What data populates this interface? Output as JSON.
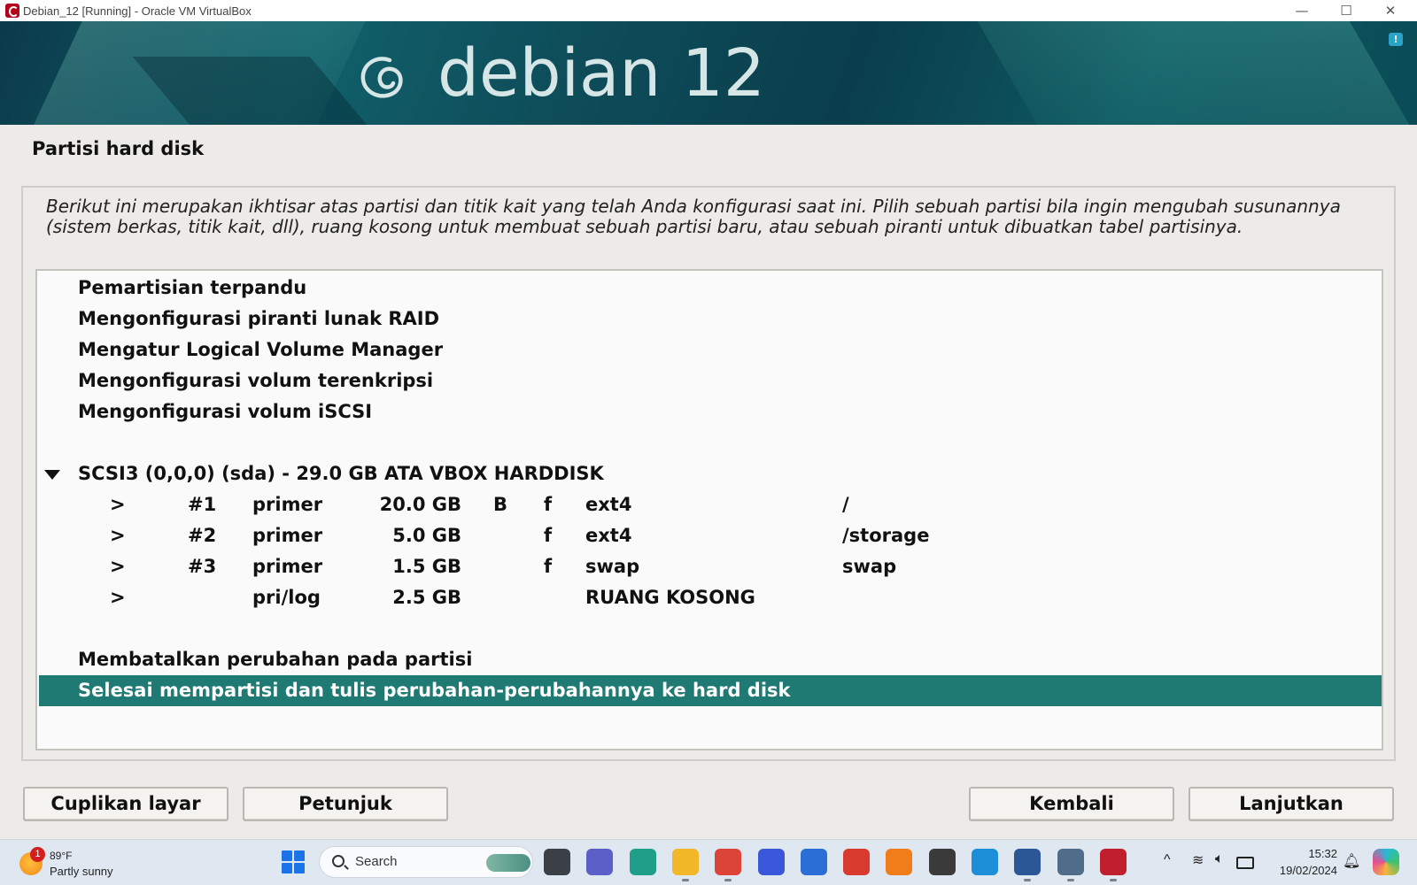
{
  "window": {
    "title": "Debian_12 [Running] - Oracle VM VirtualBox",
    "minimize_glyph": "—",
    "maximize_glyph": "☐",
    "close_glyph": "✕"
  },
  "banner": {
    "brand": "debian 12",
    "notice_glyph": "!"
  },
  "installer": {
    "title": "Partisi hard disk",
    "description": "Berikut ini merupakan ikhtisar atas partisi dan titik kait yang telah Anda konfigurasi saat ini. Pilih sebuah partisi bila ingin mengubah susunannya (sistem berkas, titik kait, dll), ruang kosong untuk membuat sebuah partisi baru, atau sebuah piranti untuk dibuatkan tabel partisinya.",
    "menu": [
      {
        "label": "Pemartisian terpandu"
      },
      {
        "label": "Mengonfigurasi piranti lunak RAID"
      },
      {
        "label": "Mengatur Logical Volume Manager"
      },
      {
        "label": "Mengonfigurasi volum terenkripsi"
      },
      {
        "label": "Mengonfigurasi volum iSCSI"
      }
    ],
    "disk": {
      "label": "SCSI3 (0,0,0) (sda) - 29.0 GB ATA VBOX HARDDISK",
      "partitions": [
        {
          "arrow": ">",
          "num": "#1",
          "type": "primer",
          "size": "20.0 GB",
          "boot": "B",
          "format": "f",
          "fs": "ext4",
          "mount": "/"
        },
        {
          "arrow": ">",
          "num": "#2",
          "type": "primer",
          "size": "5.0 GB",
          "boot": "",
          "format": "f",
          "fs": "ext4",
          "mount": "/storage"
        },
        {
          "arrow": ">",
          "num": "#3",
          "type": "primer",
          "size": "1.5 GB",
          "boot": "",
          "format": "f",
          "fs": "swap",
          "mount": "swap"
        },
        {
          "arrow": ">",
          "num": "",
          "type": "pri/log",
          "size": "2.5 GB",
          "boot": "",
          "format": "",
          "fs": "RUANG KOSONG",
          "mount": ""
        }
      ]
    },
    "undo_label": "Membatalkan perubahan pada partisi",
    "finish_label": "Selesai mempartisi dan tulis perubahan-perubahannya ke hard disk",
    "buttons": {
      "screenshot": "Cuplikan layar",
      "help": "Petunjuk",
      "back": "Kembali",
      "continue": "Lanjutkan"
    }
  },
  "taskbar": {
    "weather": {
      "badge": "1",
      "temp": "89°F",
      "condition": "Partly sunny"
    },
    "search_text": "Search",
    "tray": {
      "up_glyph": "^",
      "wifi_glyph": "≋",
      "volume_glyph": "🔈︎",
      "bell_glyph": "🔔︎"
    },
    "time": "15:32",
    "date": "19/02/2024",
    "icons": [
      {
        "name": "task-view-icon",
        "color": "#3b3f46"
      },
      {
        "name": "chat-icon",
        "color": "#5b5fc7"
      },
      {
        "name": "app-green-icon",
        "color": "#1f9e89"
      },
      {
        "name": "file-explorer-icon",
        "color": "#f2b829"
      },
      {
        "name": "chrome-icon",
        "color": "#db4437"
      },
      {
        "name": "app-m-icon",
        "color": "#3b57d9"
      },
      {
        "name": "store-icon",
        "color": "#2b6fd6"
      },
      {
        "name": "app-red-icon",
        "color": "#d83b2e"
      },
      {
        "name": "app-orange-icon",
        "color": "#f07c1a"
      },
      {
        "name": "app-g-icon",
        "color": "#3a3a3a"
      },
      {
        "name": "edge-icon",
        "color": "#1d8fd8"
      },
      {
        "name": "word-icon",
        "color": "#2b5797"
      },
      {
        "name": "virtualbox-icon",
        "color": "#4f6d8a"
      },
      {
        "name": "debian-app-icon",
        "color": "#c0202e"
      }
    ]
  }
}
